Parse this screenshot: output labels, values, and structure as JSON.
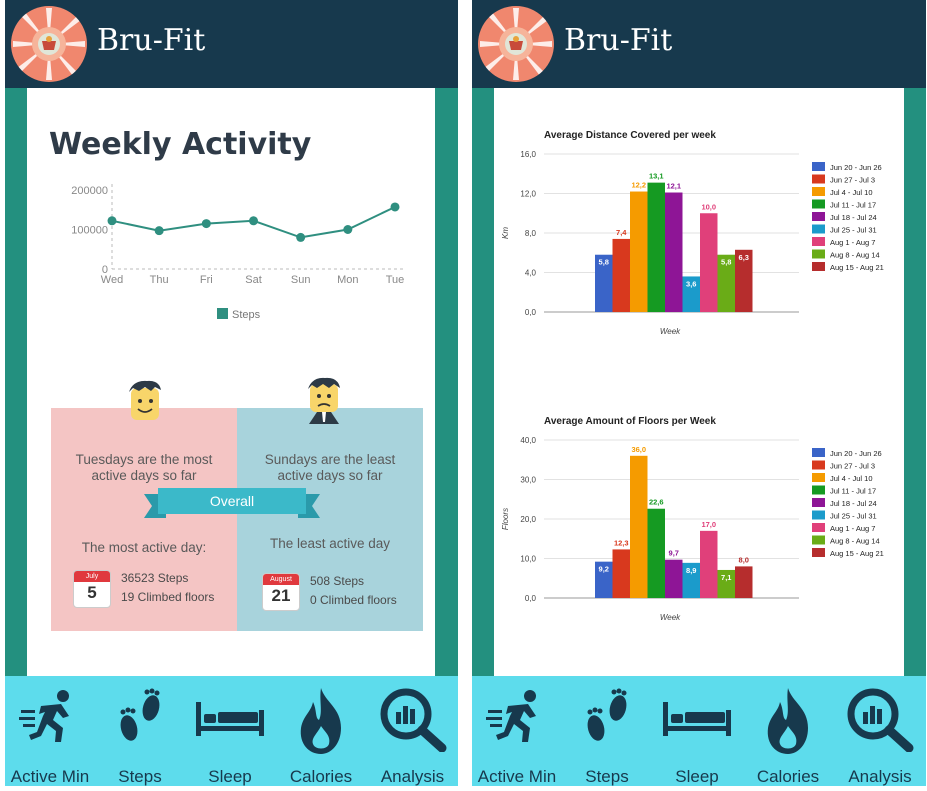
{
  "app": {
    "title": "Bru-Fit"
  },
  "nav": {
    "items": [
      {
        "label": "Active Min",
        "icon": "running-man-icon"
      },
      {
        "label": "Steps",
        "icon": "footprints-icon"
      },
      {
        "label": "Sleep",
        "icon": "bed-icon"
      },
      {
        "label": "Calories",
        "icon": "flame-icon"
      },
      {
        "label": "Analysis",
        "icon": "magnifier-chart-icon"
      }
    ]
  },
  "weekly": {
    "title": "Weekly Activity",
    "most_active": {
      "text_line1": "Tuesdays are the most",
      "text_line2": "active days so far",
      "heading": "The most active day:",
      "calendar_month": "July",
      "calendar_day": "5",
      "steps": "36523 Steps",
      "floors": "19 Climbed floors"
    },
    "overall_label": "Overall",
    "least_active": {
      "text_line1": "Sundays are the least",
      "text_line2": "active days so far",
      "heading": "The least active day",
      "calendar_month": "August",
      "calendar_day": "21",
      "steps": "508 Steps",
      "floors": "0 Climbed floors"
    }
  },
  "colors": {
    "header": "#17394d",
    "frame": "#23907f",
    "nav": "#5ddcec",
    "line": "#2f8f80",
    "pink_panel": "#f4c5c4",
    "blue_panel": "#a8d3dc",
    "ribbon": "#3bb9c9"
  },
  "chart_data": [
    {
      "type": "line",
      "title": "",
      "categories": [
        "Wed",
        "Thu",
        "Fri",
        "Sat",
        "Sun",
        "Mon",
        "Tue"
      ],
      "series": [
        {
          "name": "Steps",
          "values": [
            122000,
            97000,
            115000,
            122000,
            80000,
            100000,
            157000
          ]
        }
      ],
      "yticks": [
        "0",
        "100000",
        "200000"
      ],
      "ylim": [
        0,
        200000
      ],
      "legend": "bottom"
    },
    {
      "type": "bar",
      "title": "Average Distance Covered per week",
      "xlabel": "Week",
      "ylabel": "Km",
      "ylim": [
        0,
        16
      ],
      "yticks": [
        "0,0",
        "4,0",
        "8,0",
        "12,0",
        "16,0"
      ],
      "categories": [
        "Jun 20 - Jun 26",
        "Jun 27 - Jul 3",
        "Jul 4 - Jul 10",
        "Jul 11 - Jul 17",
        "Jul 18 - Jul 24",
        "Jul 25 - Jul 31",
        "Aug 1 - Aug 7",
        "Aug 8 - Aug 14",
        "Aug 15 - Aug 21"
      ],
      "values": [
        5.8,
        7.4,
        12.2,
        13.1,
        12.1,
        3.6,
        10.0,
        5.8,
        6.3
      ],
      "labels": [
        "5,8",
        "7,4",
        "12,2",
        "13,1",
        "12,1",
        "3,6",
        "10,0",
        "5,8",
        "6,3"
      ],
      "colors": [
        "#3a64c8",
        "#d8391e",
        "#f59b00",
        "#159a22",
        "#8e1596",
        "#1b9bcb",
        "#e0407a",
        "#6aac17",
        "#b62d2d"
      ],
      "legend": "right"
    },
    {
      "type": "bar",
      "title": "Average Amount of Floors per Week",
      "xlabel": "Week",
      "ylabel": "Floors",
      "ylim": [
        0,
        40
      ],
      "yticks": [
        "0,0",
        "10,0",
        "20,0",
        "30,0",
        "40,0"
      ],
      "categories": [
        "Jun 20 - Jun 26",
        "Jun 27 - Jul 3",
        "Jul 4 - Jul 10",
        "Jul 11 - Jul 17",
        "Jul 18 - Jul 24",
        "Jul 25 - Jul 31",
        "Aug 1 - Aug 7",
        "Aug 8 - Aug 14",
        "Aug 15 - Aug 21"
      ],
      "values": [
        9.2,
        12.3,
        36.0,
        22.6,
        9.7,
        8.9,
        17.0,
        7.1,
        8.0
      ],
      "labels": [
        "9,2",
        "12,3",
        "36,0",
        "22,6",
        "9,7",
        "8,9",
        "17,0",
        "7,1",
        "8,0"
      ],
      "colors": [
        "#3a64c8",
        "#d8391e",
        "#f59b00",
        "#159a22",
        "#8e1596",
        "#1b9bcb",
        "#e0407a",
        "#6aac17",
        "#b62d2d"
      ],
      "legend": "right"
    }
  ]
}
